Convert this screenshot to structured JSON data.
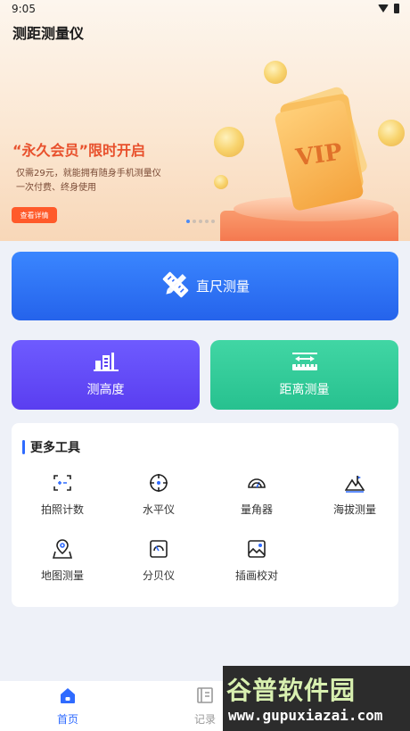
{
  "status_bar": {
    "time": "9:05"
  },
  "app": {
    "title": "测距测量仪"
  },
  "banner": {
    "headline": "“永久会员”限时开启",
    "line1": "仅需29元，就能拥有随身手机测量仪",
    "line2": "一次付费、终身使用",
    "detail_button": "查看详情",
    "card_text": "VIP"
  },
  "main": {
    "ruler_label": "直尺测量",
    "height_label": "测高度",
    "distance_label": "距离测量"
  },
  "more_tools": {
    "title": "更多工具",
    "items": [
      {
        "label": "拍照计数",
        "icon": "photo-count-icon"
      },
      {
        "label": "水平仪",
        "icon": "level-icon"
      },
      {
        "label": "量角器",
        "icon": "protractor-icon"
      },
      {
        "label": "海拔测量",
        "icon": "altitude-icon"
      },
      {
        "label": "地图测量",
        "icon": "map-measure-icon"
      },
      {
        "label": "分贝仪",
        "icon": "decibel-icon"
      },
      {
        "label": "插画校对",
        "icon": "image-calibrate-icon"
      }
    ]
  },
  "bottom_nav": {
    "items": [
      {
        "label": "首页",
        "icon": "home-icon",
        "active": true
      },
      {
        "label": "记录",
        "icon": "record-icon",
        "active": false
      }
    ]
  },
  "watermark": {
    "main": "谷普软件园",
    "url": "www.gupuxiazai.com"
  },
  "colors": {
    "primary": "#2f6bff",
    "purple": "#5a3ef0",
    "green": "#27c18f",
    "promo": "#e8502c"
  }
}
